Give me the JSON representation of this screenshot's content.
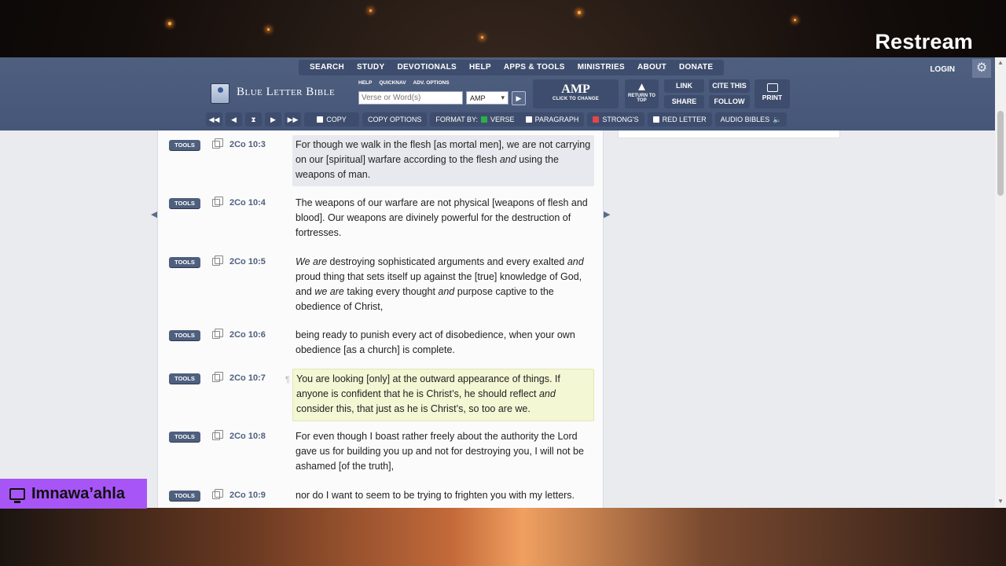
{
  "overlay": {
    "brand": "Restream",
    "streamer": "Imnawa’ahla"
  },
  "nav": {
    "items": [
      "SEARCH",
      "STUDY",
      "DEVOTIONALS",
      "HELP",
      "APPS & TOOLS",
      "MINISTRIES",
      "ABOUT",
      "DONATE"
    ],
    "login": "LOGIN"
  },
  "header": {
    "logo": "Blue Letter Bible",
    "mini_links": [
      "HELP",
      "QUICKNAV",
      "ADV. OPTIONS"
    ],
    "search_placeholder": "Verse or Word(s)",
    "version": "AMP",
    "version_button": "AMP",
    "version_hint": "CLICK TO CHANGE",
    "return_top": "RETURN TO TOP",
    "link": "LINK",
    "share": "SHARE",
    "cite": "CITE THIS",
    "follow": "FOLLOW",
    "print": "PRINT"
  },
  "toolbar": {
    "copy": "COPY",
    "copy_options": "COPY OPTIONS",
    "format_by": "FORMAT BY:",
    "verse": "VERSE",
    "paragraph": "PARAGRAPH",
    "strongs": "STRONG'S",
    "red_letter": "RED LETTER",
    "audio_bibles": "AUDIO BIBLES"
  },
  "tools_label": "TOOLS",
  "verses": [
    {
      "ref": "2Co 10:3",
      "parts": [
        [
          "For though we walk in the flesh [as mortal men], we are not carrying on our [spiritual] warfare according to the flesh ",
          false
        ],
        [
          "and",
          true
        ],
        [
          " using the weapons of man.",
          false
        ]
      ]
    },
    {
      "ref": "2Co 10:4",
      "parts": [
        [
          "The weapons of our warfare are not physical [weapons of flesh and blood]. Our weapons are divinely powerful for the destruction of fortresses.",
          false
        ]
      ]
    },
    {
      "ref": "2Co 10:5",
      "parts": [
        [
          "We are",
          true
        ],
        [
          " destroying sophisticated arguments and every exalted ",
          false
        ],
        [
          "and",
          true
        ],
        [
          " proud thing that sets itself up against the [true] knowledge of God, and ",
          false
        ],
        [
          "we are",
          true
        ],
        [
          " taking every thought ",
          false
        ],
        [
          "and",
          true
        ],
        [
          " purpose captive to the obedience of Christ,",
          false
        ]
      ]
    },
    {
      "ref": "2Co 10:6",
      "parts": [
        [
          "being ready to punish every act of disobedience, when your own obedience [as a church] is complete.",
          false
        ]
      ]
    },
    {
      "ref": "2Co 10:7",
      "parts": [
        [
          "You are looking [only] at the outward appearance of things. If anyone is confident that he is Christ’s, he should reflect ",
          false
        ],
        [
          "and",
          true
        ],
        [
          " consider this, that just as he is Christ’s, so too are we.",
          false
        ]
      ]
    },
    {
      "ref": "2Co 10:8",
      "parts": [
        [
          "For even though I boast rather freely about the authority the Lord gave us for building you up and not for destroying you, I will not be ashamed [of the truth],",
          false
        ]
      ]
    },
    {
      "ref": "2Co 10:9",
      "parts": [
        [
          "nor do I want to seem to be trying to frighten you with my letters.",
          false
        ]
      ]
    }
  ]
}
